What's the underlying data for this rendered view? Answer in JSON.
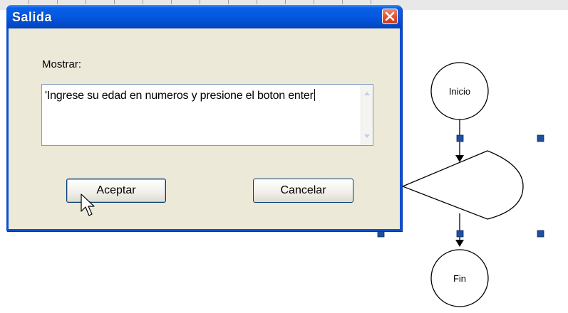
{
  "dialog": {
    "title": "Salida",
    "label": "Mostrar:",
    "text_value": "'Ingrese su edad en numeros y presione el boton enter",
    "accept_label": "Aceptar",
    "cancel_label": "Cancelar"
  },
  "flowchart": {
    "start_label": "Inicio",
    "end_label": "Fin"
  },
  "colors": {
    "titlebar": "#0558e0",
    "dialog_face": "#ece9d8",
    "handle": "#1f4f9e"
  },
  "icons": {
    "close": "close-icon",
    "cursor": "mouse-pointer-icon"
  }
}
